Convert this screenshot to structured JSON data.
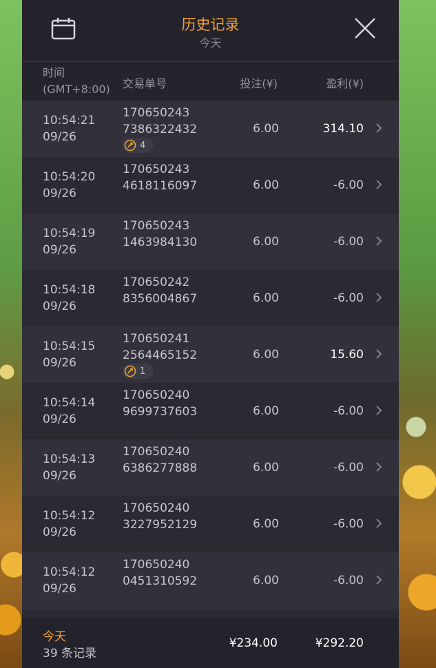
{
  "header": {
    "title": "历史记录",
    "subtitle": "今天",
    "calendar_icon": "calendar-icon",
    "close_icon": "close-icon"
  },
  "columns": {
    "time_line1": "时间",
    "time_line2": "(GMT+8:00)",
    "id": "交易单号",
    "bet": "投注(¥)",
    "win": "盈利(¥)"
  },
  "rows": [
    {
      "time": "10:54:21",
      "date": "09/26",
      "id_line1": "170650243",
      "id_line2": "7386322432",
      "bet": "6.00",
      "win": "314.10",
      "badge": "4"
    },
    {
      "time": "10:54:20",
      "date": "09/26",
      "id_line1": "170650243",
      "id_line2": "4618116097",
      "bet": "6.00",
      "win": "-6.00",
      "badge": ""
    },
    {
      "time": "10:54:19",
      "date": "09/26",
      "id_line1": "170650243",
      "id_line2": "1463984130",
      "bet": "6.00",
      "win": "-6.00",
      "badge": ""
    },
    {
      "time": "10:54:18",
      "date": "09/26",
      "id_line1": "170650242",
      "id_line2": "8356004867",
      "bet": "6.00",
      "win": "-6.00",
      "badge": ""
    },
    {
      "time": "10:54:15",
      "date": "09/26",
      "id_line1": "170650241",
      "id_line2": "2564465152",
      "bet": "6.00",
      "win": "15.60",
      "badge": "1"
    },
    {
      "time": "10:54:14",
      "date": "09/26",
      "id_line1": "170650240",
      "id_line2": "9699737603",
      "bet": "6.00",
      "win": "-6.00",
      "badge": ""
    },
    {
      "time": "10:54:13",
      "date": "09/26",
      "id_line1": "170650240",
      "id_line2": "6386277888",
      "bet": "6.00",
      "win": "-6.00",
      "badge": ""
    },
    {
      "time": "10:54:12",
      "date": "09/26",
      "id_line1": "170650240",
      "id_line2": "3227952129",
      "bet": "6.00",
      "win": "-6.00",
      "badge": ""
    },
    {
      "time": "10:54:12",
      "date": "09/26",
      "id_line1": "170650240",
      "id_line2": "0451310592",
      "bet": "6.00",
      "win": "-6.00",
      "badge": ""
    }
  ],
  "footer": {
    "period": "今天",
    "count": "39 条记录",
    "total_bet": "¥234.00",
    "total_win": "¥292.20"
  },
  "colors": {
    "accent": "#f0a23c",
    "panel": "#2b2a33",
    "row_alt": "#32313b"
  }
}
